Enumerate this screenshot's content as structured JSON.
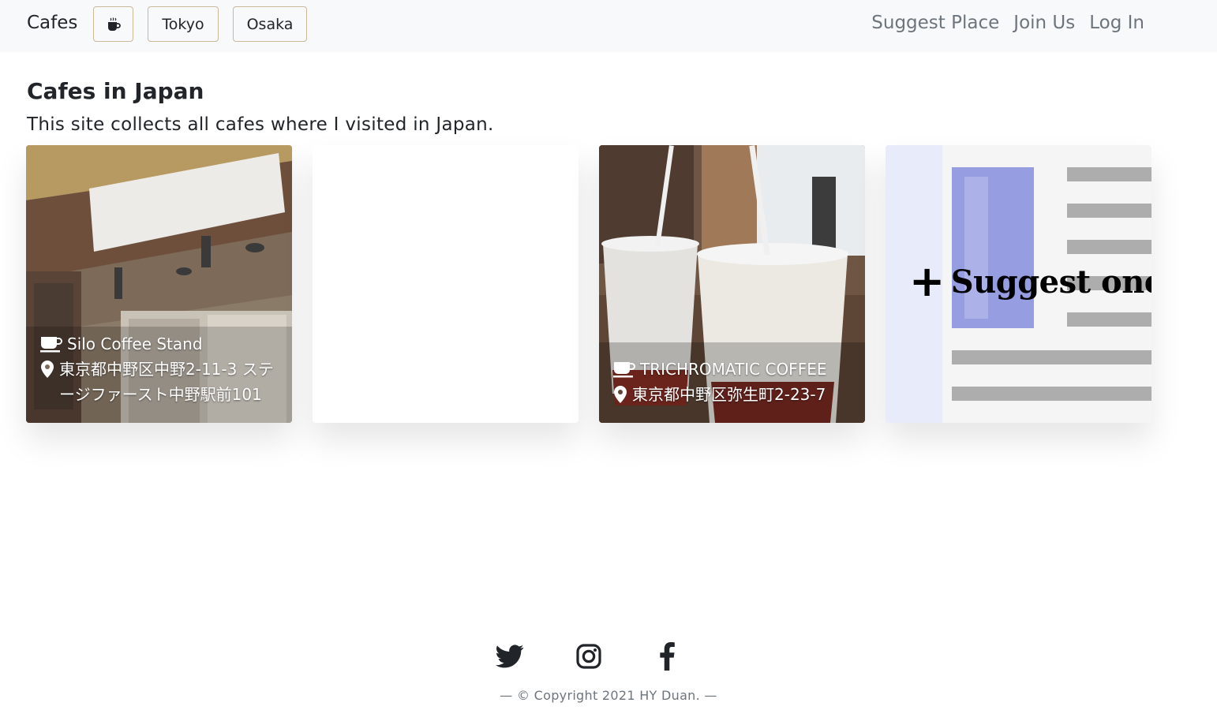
{
  "navbar": {
    "brand": "Cafes",
    "cup_button_icon": "coffee-cup-icon",
    "city_buttons": [
      "Tokyo",
      "Osaka"
    ],
    "links": [
      "Suggest Place",
      "Join Us",
      "Log In"
    ]
  },
  "main": {
    "title": "Cafes in Japan",
    "subtitle": "This site collects all cafes where I visited in Japan."
  },
  "cards": [
    {
      "name": "Silo Coffee Stand",
      "address": "東京都中野区中野2-11-3 ステージファースト中野駅前101",
      "name_icon": "mug-icon",
      "address_icon": "map-pin-icon"
    },
    {
      "name": "",
      "address": ""
    },
    {
      "name": "TRICHROMATIC COFFEE",
      "address": "東京都中野区弥生町2-23-7",
      "name_icon": "mug-icon",
      "address_icon": "map-pin-icon"
    },
    {
      "suggest_label": "Suggest one",
      "suggest_icon": "plus-icon"
    }
  ],
  "footer": {
    "social_icons": [
      "twitter-icon",
      "instagram-icon",
      "facebook-icon"
    ],
    "copyright": "— © Copyright 2021 HY Duan. —"
  },
  "colors": {
    "navbar_bg": "#f8f9fa",
    "button_border": "#c9b89a",
    "muted_text": "#6c757d",
    "text": "#212529"
  }
}
